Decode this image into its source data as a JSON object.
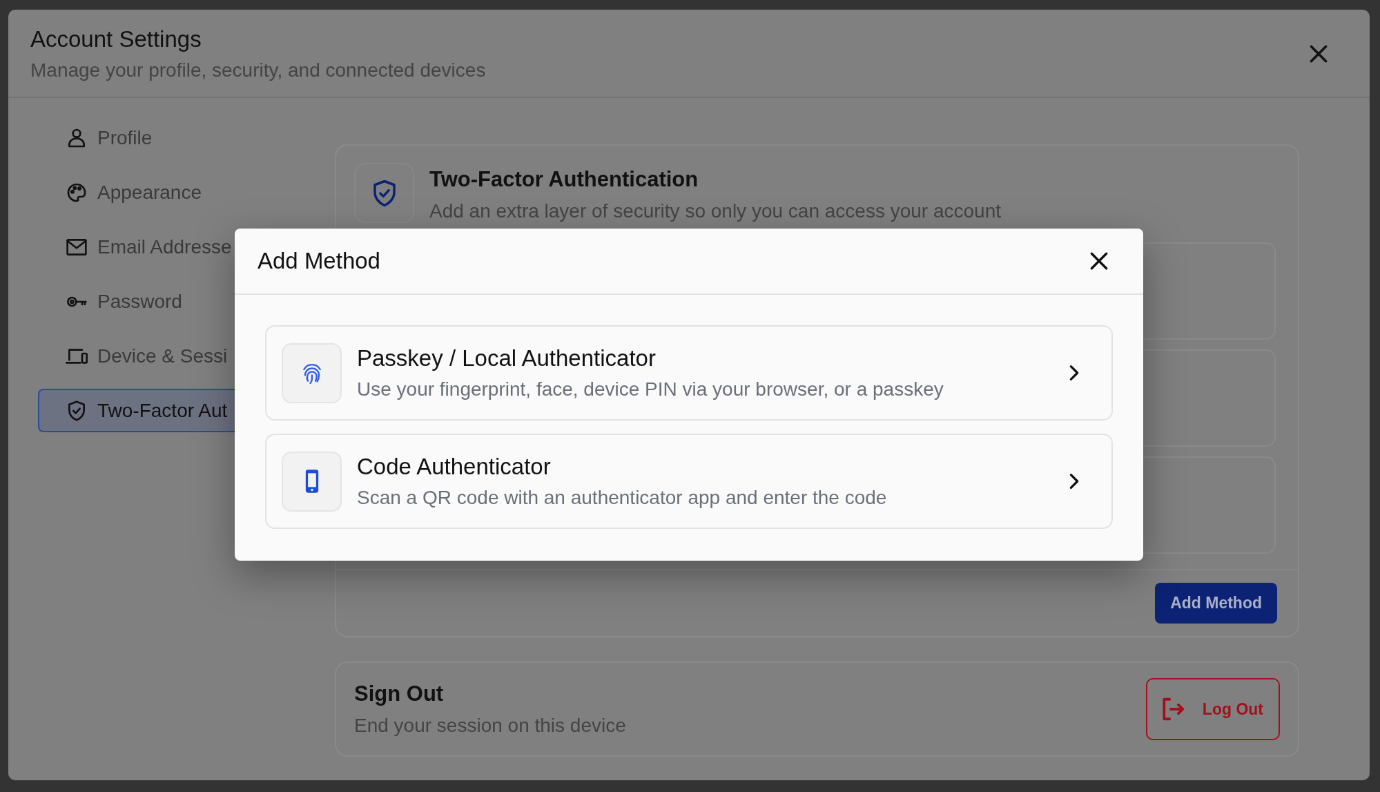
{
  "window": {
    "title": "Account Settings",
    "subtitle": "Manage your profile, security, and connected devices"
  },
  "sidebar": {
    "items": [
      {
        "kind": "profile",
        "label": "Profile",
        "selected": false
      },
      {
        "kind": "appearance",
        "label": "Appearance",
        "selected": false
      },
      {
        "kind": "email",
        "label": "Email Addresse",
        "selected": false
      },
      {
        "kind": "password",
        "label": "Password",
        "selected": false
      },
      {
        "kind": "devices",
        "label": "Device & Sessi",
        "selected": false
      },
      {
        "kind": "two-factor",
        "label": "Two-Factor Aut",
        "selected": true
      }
    ]
  },
  "two_factor": {
    "title": "Two-Factor Authentication",
    "description": "Add an extra layer of security so only you can access your account",
    "button": "Add Method"
  },
  "sign_out": {
    "title": "Sign Out",
    "description": "End your session on this device",
    "button": "Log Out"
  },
  "modal": {
    "title": "Add Method",
    "options": [
      {
        "kind": "passkey",
        "title": "Passkey / Local Authenticator",
        "description": "Use your fingerprint, face, device PIN via your browser, or a passkey"
      },
      {
        "kind": "code",
        "title": "Code Authenticator",
        "description": "Scan a QR code with an authenticator app and enter the code"
      }
    ]
  }
}
